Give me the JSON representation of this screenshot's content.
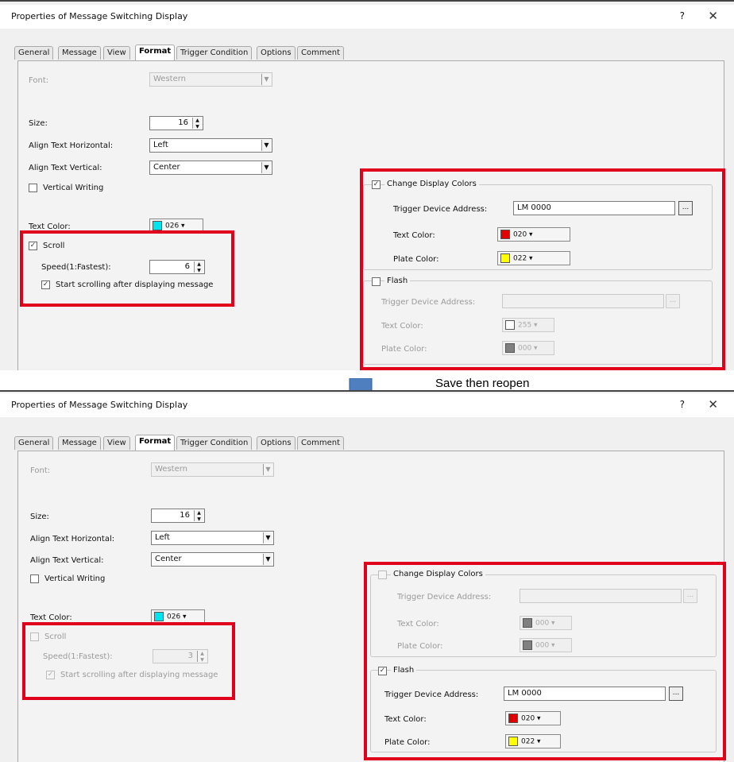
{
  "caption": "Save then reopen",
  "before": {
    "title": "Properties of Message Switching Display",
    "help": "?",
    "close": "✕",
    "tabs": [
      "General",
      "Message",
      "View",
      "Format",
      "Trigger Condition",
      "Options",
      "Comment"
    ],
    "active_tab": "Format",
    "font_label": "Font:",
    "font_value": "Western",
    "size_label": "Size:",
    "size_value": "16",
    "align_h_label": "Align Text Horizontal:",
    "align_h_value": "Left",
    "align_v_label": "Align Text Vertical:",
    "align_v_value": "Center",
    "vertical_writing": "Vertical Writing",
    "text_color_label": "Text Color:",
    "text_color_value": "026",
    "scroll_label": "Scroll",
    "scroll_checked": true,
    "speed_label": "Speed(1:Fastest):",
    "speed_value": "6",
    "start_scroll_label": "Start scrolling after displaying message",
    "start_scroll_checked": true,
    "change_colors_label": "Change Display Colors",
    "change_colors_checked": true,
    "cdc_trigger_label": "Trigger Device Address:",
    "cdc_trigger_value": "LM 0000",
    "cdc_text_color_label": "Text Color:",
    "cdc_text_color_value": "020",
    "cdc_plate_color_label": "Plate Color:",
    "cdc_plate_color_value": "022",
    "flash_label": "Flash",
    "flash_checked": false,
    "fl_trigger_label": "Trigger Device Address:",
    "fl_trigger_value": "",
    "fl_text_color_label": "Text Color:",
    "fl_text_color_value": "255",
    "fl_plate_color_label": "Plate Color:",
    "fl_plate_color_value": "000"
  },
  "after": {
    "title": "Properties of Message Switching Display",
    "help": "?",
    "close": "✕",
    "tabs": [
      "General",
      "Message",
      "View",
      "Format",
      "Trigger Condition",
      "Options",
      "Comment"
    ],
    "active_tab": "Format",
    "font_label": "Font:",
    "font_value": "Western",
    "size_label": "Size:",
    "size_value": "16",
    "align_h_label": "Align Text Horizontal:",
    "align_h_value": "Left",
    "align_v_label": "Align Text Vertical:",
    "align_v_value": "Center",
    "vertical_writing": "Vertical Writing",
    "text_color_label": "Text Color:",
    "text_color_value": "026",
    "scroll_label": "Scroll",
    "scroll_checked": false,
    "speed_label": "Speed(1:Fastest):",
    "speed_value": "3",
    "start_scroll_label": "Start scrolling after displaying message",
    "start_scroll_checked": true,
    "change_colors_label": "Change Display Colors",
    "change_colors_checked": false,
    "cdc_trigger_label": "Trigger Device Address:",
    "cdc_trigger_value": "",
    "cdc_text_color_label": "Text Color:",
    "cdc_text_color_value": "000",
    "cdc_plate_color_label": "Plate Color:",
    "cdc_plate_color_value": "000",
    "flash_label": "Flash",
    "flash_checked": true,
    "fl_trigger_label": "Trigger Device Address:",
    "fl_trigger_value": "LM 0000",
    "fl_text_color_label": "Text Color:",
    "fl_text_color_value": "020",
    "fl_plate_color_label": "Plate Color:",
    "fl_plate_color_value": "022"
  },
  "colors": {
    "cyan": "#00e5ee",
    "red": "#e00000",
    "yellow": "#ffff00",
    "white": "#ffffff",
    "gray": "#808080",
    "highlight": "#e0001b",
    "arrow": "#4f7fbf"
  }
}
